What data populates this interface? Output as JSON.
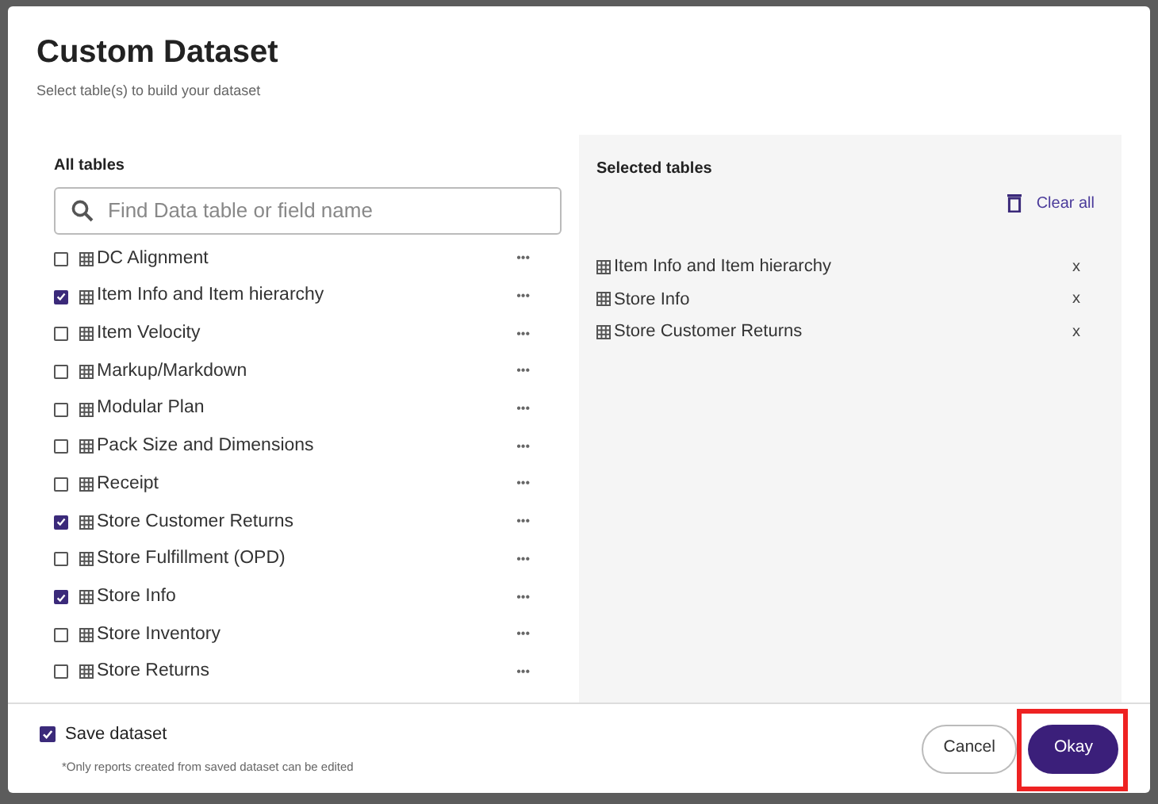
{
  "dialog": {
    "title": "Custom Dataset",
    "subtitle": "Select table(s) to build your dataset"
  },
  "all_tables": {
    "heading": "All tables",
    "search": {
      "placeholder": "Find Data table or field name"
    },
    "items": [
      {
        "label": "DC Alignment",
        "checked": false,
        "menu": "•••"
      },
      {
        "label": "Item Info and Item hierarchy",
        "checked": true,
        "menu": "•••"
      },
      {
        "label": "Item Velocity",
        "checked": false,
        "menu": "•••"
      },
      {
        "label": "Markup/Markdown",
        "checked": false,
        "menu": "•••"
      },
      {
        "label": "Modular Plan",
        "checked": false,
        "menu": "•••"
      },
      {
        "label": "Pack Size and Dimensions",
        "checked": false,
        "menu": "•••"
      },
      {
        "label": "Receipt",
        "checked": false,
        "menu": "•••"
      },
      {
        "label": "Store Customer Returns",
        "checked": true,
        "menu": "•••"
      },
      {
        "label": "Store Fulfillment (OPD)",
        "checked": false,
        "menu": "•••"
      },
      {
        "label": "Store Info",
        "checked": true,
        "menu": "•••"
      },
      {
        "label": "Store Inventory",
        "checked": false,
        "menu": "•••"
      },
      {
        "label": "Store Returns",
        "checked": false,
        "menu": "•••"
      }
    ]
  },
  "selected_tables": {
    "heading": "Selected tables",
    "clear_all": "Clear all",
    "items": [
      {
        "label": "Item Info and Item hierarchy",
        "remove": "x"
      },
      {
        "label": "Store Info",
        "remove": "x"
      },
      {
        "label": "Store Customer Returns",
        "remove": "x"
      }
    ]
  },
  "footer": {
    "save_dataset": {
      "label": "Save dataset",
      "checked": true
    },
    "note": "*Only reports created from saved dataset can be edited",
    "buttons": [
      {
        "label": "Cancel",
        "kind": "secondary",
        "highlighted": false
      },
      {
        "label": "Okay",
        "kind": "primary",
        "highlighted": true
      }
    ]
  }
}
